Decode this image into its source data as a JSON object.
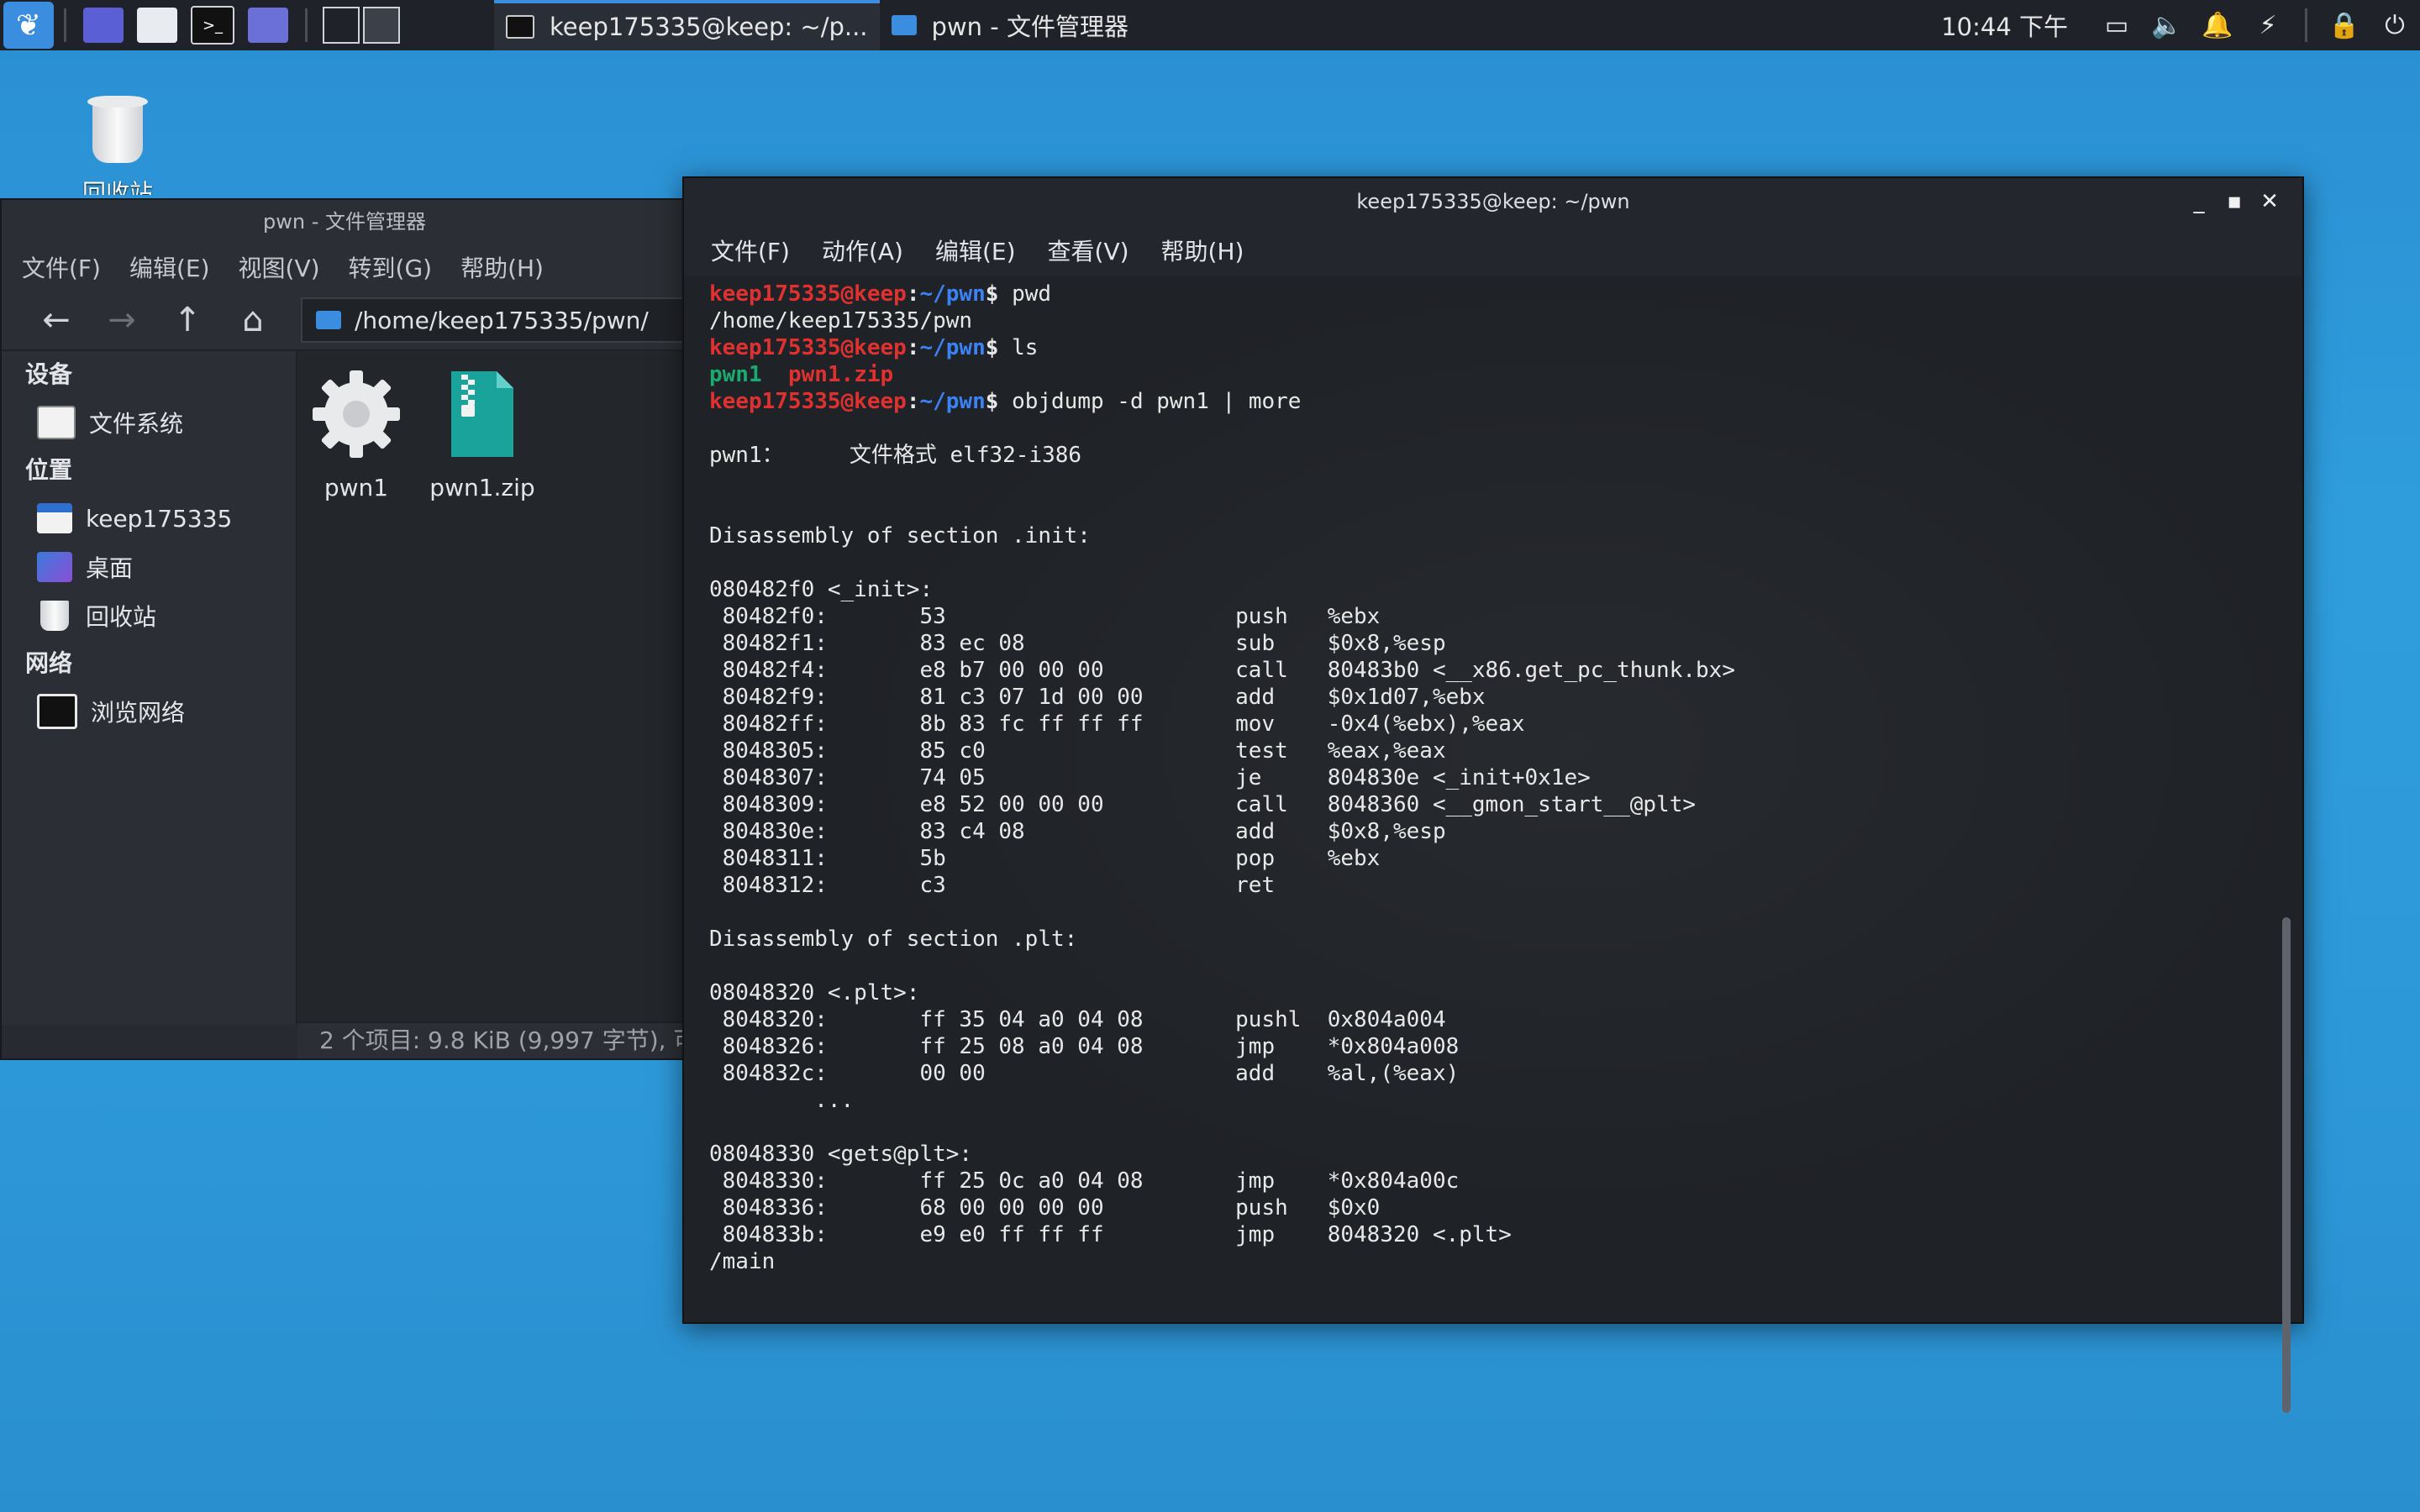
{
  "taskbar": {
    "tasks": [
      {
        "label": "keep175335@keep: ~/p..."
      },
      {
        "label": "pwn - 文件管理器"
      }
    ],
    "clock": "10:44 下午"
  },
  "desktop": {
    "trash_label": "回收站"
  },
  "file_manager": {
    "title": "pwn - 文件管理器",
    "menu": [
      "文件(F)",
      "编辑(E)",
      "视图(V)",
      "转到(G)",
      "帮助(H)"
    ],
    "path": "/home/keep175335/pwn/",
    "sidebar": {
      "devices_header": "设备",
      "devices": [
        {
          "label": "文件系统"
        }
      ],
      "places_header": "位置",
      "places": [
        {
          "label": "keep175335"
        },
        {
          "label": "桌面"
        },
        {
          "label": "回收站"
        }
      ],
      "network_header": "网络",
      "network": [
        {
          "label": "浏览网络"
        }
      ]
    },
    "files": [
      {
        "name": "pwn1"
      },
      {
        "name": "pwn1.zip"
      }
    ],
    "status": "2 个项目: 9.8 KiB (9,997 字节), 可"
  },
  "terminal": {
    "title": "keep175335@keep: ~/pwn",
    "menu": [
      "文件(F)",
      "动作(A)",
      "编辑(E)",
      "查看(V)",
      "帮助(H)"
    ],
    "prompt_user": "keep175335@keep",
    "prompt_path": "~/pwn",
    "commands": [
      "pwd",
      "ls",
      "objdump -d pwn1 | more"
    ],
    "pwd_output": "/home/keep175335/pwn",
    "ls_output": [
      "pwn1",
      "pwn1.zip"
    ],
    "output_lines": [
      "",
      "pwn1：     文件格式 elf32-i386",
      "",
      "",
      "Disassembly of section .init:",
      "",
      "080482f0 <_init>:",
      " 80482f0:\t53                   \tpush   %ebx",
      " 80482f1:\t83 ec 08             \tsub    $0x8,%esp",
      " 80482f4:\te8 b7 00 00 00       \tcall   80483b0 <__x86.get_pc_thunk.bx>",
      " 80482f9:\t81 c3 07 1d 00 00    \tadd    $0x1d07,%ebx",
      " 80482ff:\t8b 83 fc ff ff ff    \tmov    -0x4(%ebx),%eax",
      " 8048305:\t85 c0                \ttest   %eax,%eax",
      " 8048307:\t74 05                \tje     804830e <_init+0x1e>",
      " 8048309:\te8 52 00 00 00       \tcall   8048360 <__gmon_start__@plt>",
      " 804830e:\t83 c4 08             \tadd    $0x8,%esp",
      " 8048311:\t5b                   \tpop    %ebx",
      " 8048312:\tc3                   \tret",
      "",
      "Disassembly of section .plt:",
      "",
      "08048320 <.plt>:",
      " 8048320:\tff 35 04 a0 04 08    \tpushl  0x804a004",
      " 8048326:\tff 25 08 a0 04 08    \tjmp    *0x804a008",
      " 804832c:\t00 00                \tadd    %al,(%eax)",
      "\t...",
      "",
      "08048330 <gets@plt>:",
      " 8048330:\tff 25 0c a0 04 08    \tjmp    *0x804a00c",
      " 8048336:\t68 00 00 00 00       \tpush   $0x0",
      " 804833b:\te9 e0 ff ff ff       \tjmp    8048320 <.plt>",
      "/main"
    ]
  },
  "colors": {
    "prompt_user": "#e03131",
    "prompt_path": "#3b82f6",
    "accent": "#3b8de0",
    "desktop": "#2d98d8"
  }
}
